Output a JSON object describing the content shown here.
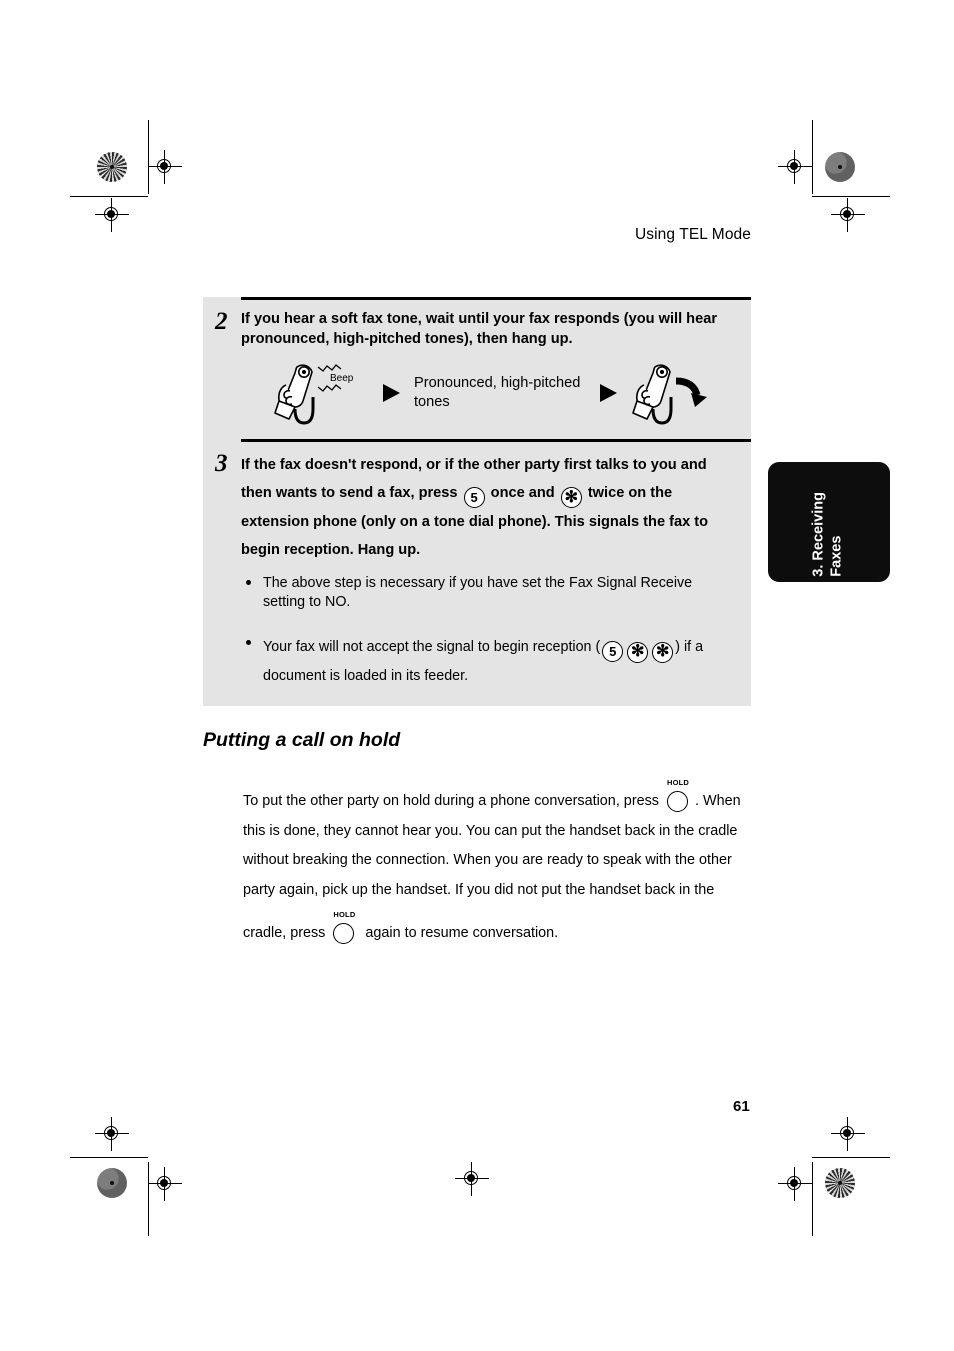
{
  "page": {
    "running_head": "Using TEL Mode",
    "page_number": "61"
  },
  "side_tab": {
    "label": "3. Receiving\nFaxes",
    "background": "#0d0d0d",
    "text_color": "#ffffff"
  },
  "panel": {
    "background": "#e4e4e4",
    "steps": [
      {
        "number": "2",
        "text": "If you hear a soft fax tone, wait until your fax responds (you will hear pronounced, high-pitched tones), then hang up.",
        "illustration": {
          "beep_label": "Beep",
          "arrow_label": "Pronounced, high-pitched tones"
        }
      },
      {
        "number": "3",
        "text_part_1": "If the fax doesn't respond, or if the other party first talks to you and then wants to send a fax, press ",
        "key_1": "5",
        "text_part_2": " once and ",
        "key_2": "✻",
        "text_part_3": " twice on the extension phone (only on a tone dial phone). This signals the fax to begin reception. Hang up."
      }
    ],
    "bullets": [
      {
        "text": "The above step is necessary if you have set the Fax Signal Receive setting to NO."
      },
      {
        "text_part_1": "Your fax will not accept the signal to begin reception (",
        "key_1": "5",
        "key_2": "✻",
        "key_3": "✻",
        "text_part_2": ") if a document is loaded in its feeder."
      }
    ]
  },
  "hold_section": {
    "heading": "Putting a call on hold",
    "text_part_1": "To put the other party on hold during a phone conversation, press ",
    "hold_key_label": "HOLD",
    "text_part_2": ". When this is done, they cannot hear you. You can put the handset back in the cradle without breaking the connection. When you are ready to speak with the other party again, pick up the handset. If you did not put the handset back in the",
    "text_part_3": "cradle, press ",
    "text_part_4": " again to resume conversation."
  }
}
